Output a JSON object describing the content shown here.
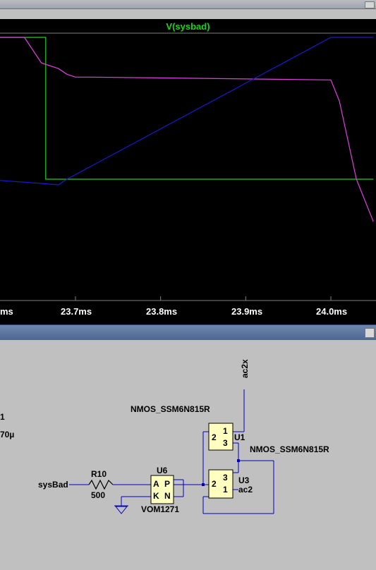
{
  "waveform": {
    "trace_name": "V(sysbad)",
    "x_ticks": [
      "ms",
      "23.7ms",
      "23.8ms",
      "23.9ms",
      "24.0ms"
    ]
  },
  "chart_data": {
    "type": "line",
    "title": "V(sysbad)",
    "x_unit": "ms",
    "x_ticks": [
      "23.7ms",
      "23.8ms",
      "23.9ms",
      "24.0ms"
    ],
    "series": [
      {
        "name": "V(sysbad)",
        "color": "#1fd21f",
        "x": [
          23.59,
          23.665,
          23.665,
          24.05
        ],
        "y": [
          1,
          1,
          0,
          0
        ]
      },
      {
        "color": "#e040e0",
        "x": [
          23.59,
          23.64,
          23.66,
          23.68,
          23.69,
          23.7,
          23.72,
          24.0,
          24.01,
          24.03,
          24.05
        ],
        "y": [
          1.0,
          1.0,
          0.82,
          0.78,
          0.74,
          0.72,
          0.72,
          0.7,
          0.55,
          0.0,
          -0.3
        ]
      },
      {
        "color": "#1a1ad0",
        "x": [
          23.59,
          23.66,
          23.68,
          23.69,
          24.0,
          24.05
        ],
        "y": [
          0.0,
          -0.03,
          -0.04,
          0.0,
          1.0,
          1.0
        ]
      }
    ]
  },
  "schematic": {
    "left_values": [
      "1",
      "70µ"
    ],
    "input_label": "sysBad",
    "resistor": {
      "ref": "R10",
      "value": "500"
    },
    "opto": {
      "ref": "U6",
      "model": "VOM1271",
      "pins": [
        "A",
        "P",
        "K",
        "N"
      ]
    },
    "mos1": {
      "ref": "U1",
      "model": "NMOS_SSM6N815R",
      "pins": [
        "2",
        "1",
        "3"
      ],
      "net": "ac2x"
    },
    "mos2": {
      "ref": "U3",
      "model": "NMOS_SSM6N815R",
      "pins": [
        "2",
        "3",
        "1"
      ],
      "net": "ac2"
    }
  },
  "colors": {
    "wire": "#0000c0",
    "component_fill": "#ffffc0",
    "trace_green": "#1fd21f",
    "trace_magenta": "#e040e0",
    "trace_blue": "#1a1ad0"
  }
}
